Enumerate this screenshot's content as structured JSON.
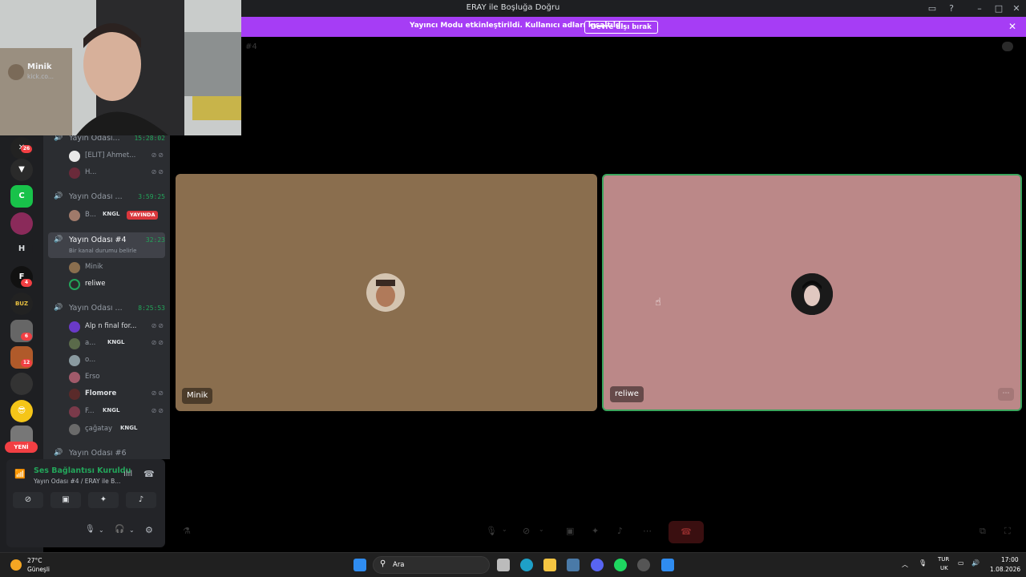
{
  "window": {
    "title": "ERAY ile Boşluğa Doğru",
    "controls": [
      "inbox-icon",
      "help-icon",
      "minimize-icon",
      "maximize-icon",
      "close-icon"
    ]
  },
  "banner": {
    "message": "Yayıncı Modu etkinleştirildi. Kullanıcı adları kısaltıldı.",
    "button": "Devre dışı bırak",
    "color": "#a63df5"
  },
  "guilds": {
    "badges": [
      "26",
      "4",
      "6",
      "12"
    ],
    "new_label": "YENİ",
    "letter_server": "H"
  },
  "sidebar": {
    "channels": [
      {
        "name": "Yayın Odası...",
        "time": "15:28:02",
        "members": [
          {
            "name": "[ELIT] Ahmet..."
          },
          {
            "name": "H..."
          }
        ]
      },
      {
        "name": "Yayın Odası ...",
        "time": "3:59:25",
        "members": [
          {
            "name": "B...",
            "tag": "KNGL",
            "live": "YAYINDA"
          }
        ]
      },
      {
        "name": "Yayın Odası #4",
        "time": "32:23",
        "status": "Bir kanal durumu belirle",
        "members": [
          {
            "name": "Minik"
          },
          {
            "name": "reliwe"
          }
        ]
      },
      {
        "name": "Yayın Odası ...",
        "time": "8:25:53",
        "members": [
          {
            "name": "Alp n final for..."
          },
          {
            "name": "a...",
            "tag": "KNGL"
          },
          {
            "name": "o..."
          },
          {
            "name": "Erso"
          },
          {
            "name": "Flomore"
          },
          {
            "name": "F...",
            "tag": "KNGL"
          },
          {
            "name": "çağatay",
            "tag": "KNGL"
          }
        ]
      },
      {
        "name": "Yayın Odası #6"
      }
    ]
  },
  "voice_panel": {
    "status": "Ses Bağlantısı Kuruldu",
    "subtitle": "Yayın Odası #4 / ERAY ile B...",
    "status_color": "#23a55a"
  },
  "user": {
    "name": "Minik",
    "subtitle": "kick.co..."
  },
  "main": {
    "channel_hint": "#4",
    "tiles": [
      {
        "name": "Minik",
        "bg": "#8a6e4e"
      },
      {
        "name": "reliwe",
        "bg": "#bb8888",
        "speaking": true
      }
    ]
  },
  "taskbar": {
    "weather_temp": "27°C",
    "weather_desc": "Güneşli",
    "search_label": "Ara",
    "lang_top": "TUR",
    "lang_bottom": "UK",
    "time": "17:00",
    "date": "1.08.2026"
  }
}
